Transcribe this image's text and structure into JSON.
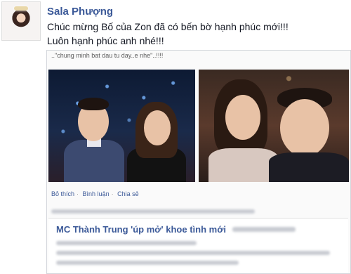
{
  "post": {
    "author": "Sala Phượng",
    "message_line1": "Chúc mừng Bố của Zon đã có bến bờ hạnh phúc mới!!!",
    "message_line2": "Luôn hạnh phúc anh nhé!!!"
  },
  "shared": {
    "caption": "..\"chung minh bat dau tu day..e nhe\"..!!!!",
    "actions": {
      "like": "Bỏ thích",
      "comment": "Bình luận",
      "share": "Chia sẻ",
      "separator": "·"
    },
    "article_title": "MC Thành Trung 'úp mở' khoe tình mới"
  }
}
